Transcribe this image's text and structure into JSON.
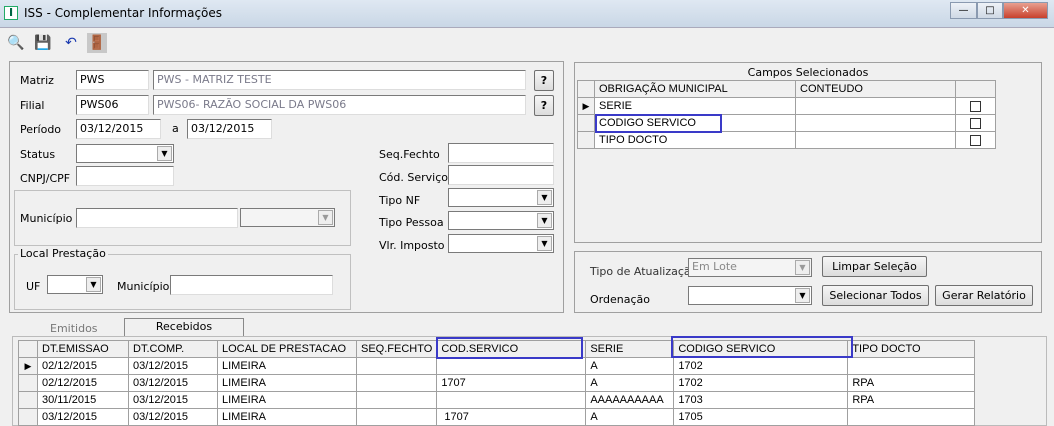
{
  "window": {
    "title": "ISS - Complementar Informações",
    "minimize": "—",
    "maximize": "□",
    "close": "✕"
  },
  "toolbar": {
    "search": "🔍",
    "save": "💾",
    "undo": "↶",
    "exit": "🚪"
  },
  "form": {
    "matriz_label": "Matriz",
    "matriz_code": "PWS",
    "matriz_desc": "PWS - MATRIZ TESTE",
    "filial_label": "Filial",
    "filial_code": "PWS06",
    "filial_desc": "PWS06- RAZÃO SOCIAL DA PWS06",
    "help": "?",
    "periodo_label": "Período",
    "periodo_from": "03/12/2015",
    "periodo_sep": "a",
    "periodo_to": "03/12/2015",
    "status_label": "Status",
    "status_value": "",
    "cnpj_label": "CNPJ/CPF",
    "cnpj_value": "",
    "municipio_label": "Município",
    "local_group": "Local Prestação",
    "uf_label": "UF",
    "local_municipio_label": "Município",
    "seq_label": "Seq.Fechto",
    "cod_label": "Cód. Serviço",
    "tiponf_label": "Tipo NF",
    "tipopessoa_label": "Tipo Pessoa",
    "vlr_label": "Vlr. Imposto"
  },
  "campos": {
    "title": "Campos Selecionados",
    "headers": [
      "OBRIGAÇÃO MUNICIPAL",
      "CONTEUDO"
    ],
    "rows": [
      {
        "obrig": "SERIE",
        "conteudo": ""
      },
      {
        "obrig": "CODIGO SERVICO",
        "conteudo": ""
      },
      {
        "obrig": "TIPO DOCTO",
        "conteudo": ""
      }
    ]
  },
  "options": {
    "tipo_label": "Tipo de Atualização",
    "tipo_value": "Em Lote",
    "ordenacao_label": "Ordenação",
    "limpar": "Limpar Seleção",
    "selecionar": "Selecionar Todos",
    "gerar": "Gerar Relatório"
  },
  "tabs": [
    "Emitidos",
    "Recebidos"
  ],
  "grid": {
    "headers": [
      "DT.EMISSAO",
      "DT.COMP.",
      "LOCAL DE PRESTACAO",
      "SEQ.FECHTO",
      "COD.SERVICO",
      "SERIE",
      "CODIGO SERVICO",
      "TIPO DOCTO"
    ],
    "rows": [
      [
        "02/12/2015",
        "03/12/2015",
        "LIMEIRA",
        "",
        "",
        "A",
        "1702",
        ""
      ],
      [
        "02/12/2015",
        "03/12/2015",
        "LIMEIRA",
        "",
        "1707",
        "A",
        "1702",
        "RPA"
      ],
      [
        "30/11/2015",
        "03/12/2015",
        "LIMEIRA",
        "",
        "",
        "AAAAAAAAAA",
        "1703",
        "RPA"
      ],
      [
        "03/12/2015",
        "03/12/2015",
        "LIMEIRA",
        "",
        " 1707",
        "A",
        "1705",
        ""
      ]
    ]
  }
}
